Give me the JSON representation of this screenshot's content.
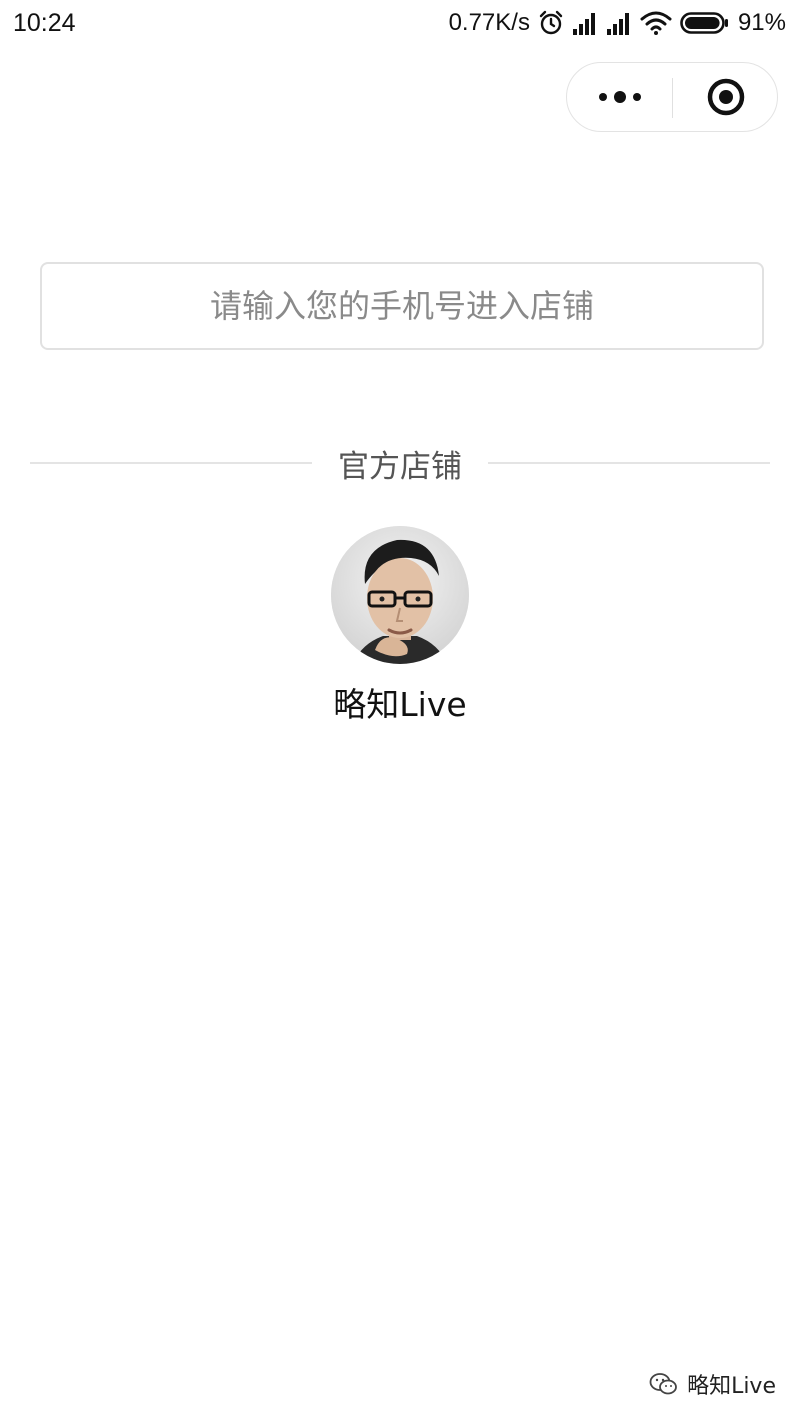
{
  "status_bar": {
    "time": "10:24",
    "network_speed": "0.77K/s",
    "battery_percent": "91%",
    "battery_level": 0.91,
    "icons": [
      "alarm-icon",
      "signal-icon",
      "signal-icon",
      "wifi-icon",
      "battery-icon"
    ]
  },
  "capsule": {
    "more_icon": "more-dots-icon",
    "close_icon": "target-circle-icon"
  },
  "search": {
    "placeholder": "请输入您的手机号进入店铺",
    "value": ""
  },
  "section": {
    "title": "官方店铺"
  },
  "stores": [
    {
      "name": "略知Live",
      "avatar_icon": "avatar"
    }
  ],
  "watermark": {
    "icon": "wechat-logo-icon",
    "text": "略知Live"
  },
  "colors": {
    "background": "#ffffff",
    "border": "#e1e1e1",
    "placeholder": "#8a8a8a",
    "heading_text": "#555555",
    "divider": "#e4e4e4"
  }
}
